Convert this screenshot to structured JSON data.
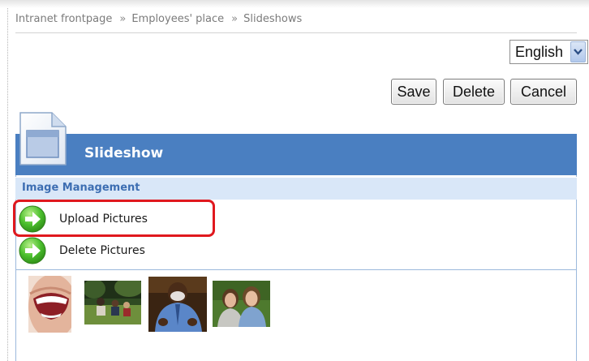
{
  "breadcrumb": {
    "items": [
      "Intranet frontpage",
      "Employees' place",
      "Slideshows"
    ],
    "separator": "»"
  },
  "language": {
    "selected": "English"
  },
  "toolbar": {
    "save_label": "Save",
    "delete_label": "Delete",
    "cancel_label": "Cancel"
  },
  "header": {
    "title": "Slideshow"
  },
  "section": {
    "title": "Image Management"
  },
  "actions": [
    {
      "label": "Upload Pictures",
      "icon": "green-arrow-right-icon",
      "highlighted": true
    },
    {
      "label": "Delete Pictures",
      "icon": "green-arrow-right-icon",
      "highlighted": false
    }
  ],
  "thumbnails": [
    {
      "name": "smiling-mouth-thumbnail"
    },
    {
      "name": "people-on-lawn-thumbnail"
    },
    {
      "name": "man-in-blue-shirt-thumbnail"
    },
    {
      "name": "two-women-outdoors-thumbnail"
    }
  ],
  "colors": {
    "header_bar": "#4a7fc1",
    "section_bg": "#d9e7f8",
    "section_text": "#3d6eb2",
    "highlight": "#e0181e",
    "action_icon": "#3fae2a"
  }
}
